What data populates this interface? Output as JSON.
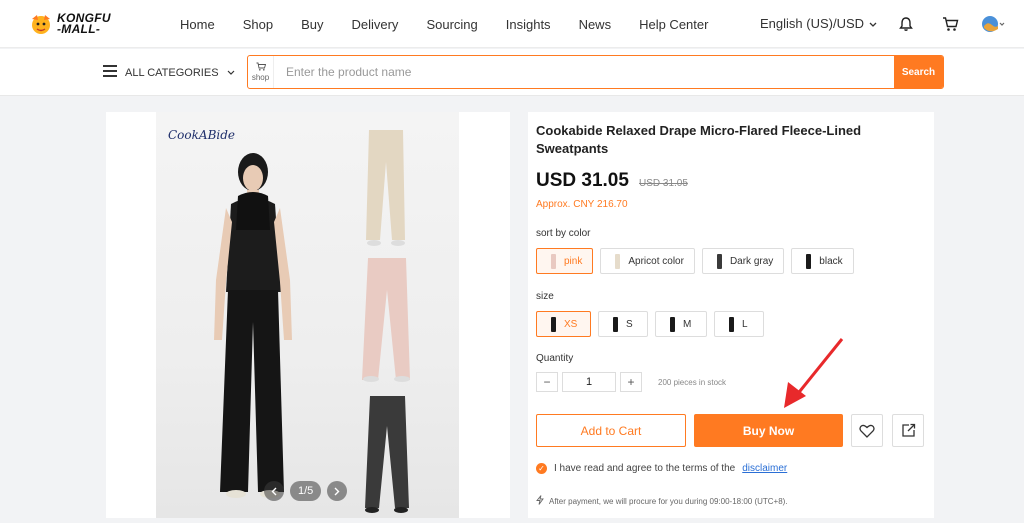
{
  "header": {
    "logo_line1": "KONGFU",
    "logo_line2": "-MALL-",
    "nav": [
      "Home",
      "Shop",
      "Buy",
      "Delivery",
      "Sourcing",
      "Insights",
      "News",
      "Help Center"
    ],
    "language": "English (US)/USD"
  },
  "search": {
    "all_categories": "ALL CATEGORIES",
    "shop_label": "shop",
    "placeholder": "Enter the product name",
    "button": "Search"
  },
  "gallery": {
    "brand": "CookABide",
    "pager": "1/5"
  },
  "product": {
    "title": "Cookabide Relaxed Drape Micro-Flared Fleece-Lined Sweatpants",
    "price": "USD 31.05",
    "old_price": "USD 31.05",
    "approx": "Approx. CNY 216.70",
    "color_label": "sort by color",
    "colors": [
      {
        "name": "pink",
        "swatch": "#e9c9c1",
        "selected": true
      },
      {
        "name": "Apricot color",
        "swatch": "#e6dccb",
        "selected": false
      },
      {
        "name": "Dark gray",
        "swatch": "#3a3a3a",
        "selected": false
      },
      {
        "name": "black",
        "swatch": "#1a1a1a",
        "selected": false
      }
    ],
    "size_label": "size",
    "sizes": [
      {
        "name": "XS",
        "selected": true
      },
      {
        "name": "S",
        "selected": false
      },
      {
        "name": "M",
        "selected": false
      },
      {
        "name": "L",
        "selected": false
      }
    ],
    "quantity_label": "Quantity",
    "quantity": "1",
    "stock": "200 pieces in stock",
    "add_to_cart": "Add to Cart",
    "buy_now": "Buy Now",
    "agree_text": "I have read and agree to the terms of the",
    "disclaimer": "disclaimer",
    "note": "After payment, we will procure for you during 09:00-18:00 (UTC+8)."
  },
  "colors": {
    "accent": "#ff7a21",
    "link": "#2a6fd6",
    "annotation": "#e8292b"
  }
}
